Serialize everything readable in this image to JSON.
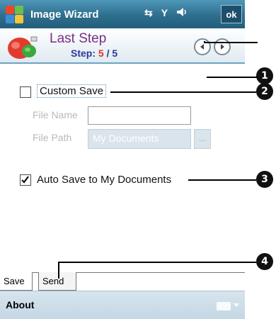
{
  "titlebar": {
    "title": "Image Wizard",
    "ok_label": "ok",
    "icons": [
      "start-logo",
      "connectivity-icon",
      "signal-icon",
      "speaker-icon"
    ]
  },
  "header": {
    "title": "Last Step",
    "step_prefix": "Step: ",
    "step_current": "5",
    "step_sep": " / ",
    "step_total": "5",
    "icons": [
      "wizard-art",
      "back-arrow-icon",
      "next-arrow-icon"
    ]
  },
  "form": {
    "custom_save": {
      "label": "Custom Save",
      "checked": false
    },
    "file_name": {
      "label": "File Name",
      "value": ""
    },
    "file_path": {
      "label": "File Path",
      "value": "My Documents",
      "browse_label": "..."
    },
    "auto_save": {
      "label": "Auto Save to My Documents",
      "checked": true
    }
  },
  "tabs": [
    {
      "label": "Save"
    },
    {
      "label": "Send"
    }
  ],
  "menubar": {
    "left_label": "About",
    "icons": [
      "keyboard-icon"
    ]
  },
  "callouts": [
    "1",
    "2",
    "3",
    "4"
  ],
  "colors": {
    "titlebar": "#2e6e8e",
    "header_title": "#7a2d86",
    "step_text": "#2c3a9a",
    "step_current": "#e0302b",
    "menubar": "#c4d7e4"
  }
}
